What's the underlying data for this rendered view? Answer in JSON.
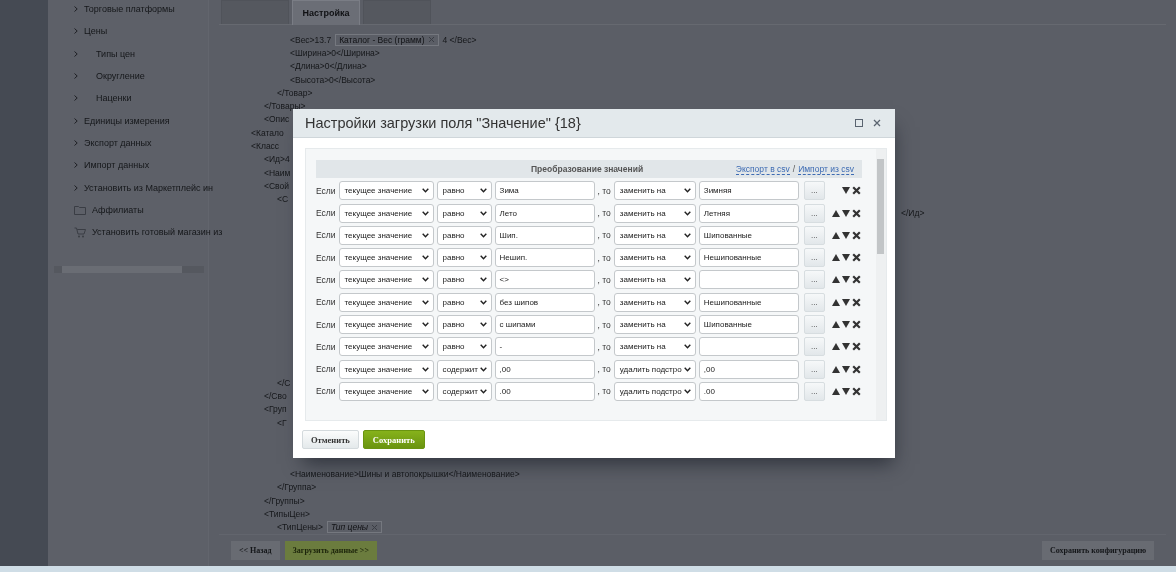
{
  "sidebar": {
    "items": [
      {
        "children": [
          {
            "label": "Торговые платформы"
          },
          {
            "label": "Цены",
            "children": [
              {
                "label": "Типы цен"
              },
              {
                "label": "Округление"
              },
              {
                "label": "Наценки"
              }
            ]
          },
          {
            "label": "Единицы измерения"
          },
          {
            "label": "Экспорт данных"
          },
          {
            "label": "Импорт данных"
          },
          {
            "label": "Установить из Маркетплейс ин"
          }
        ]
      },
      {
        "label": "Аффилиаты",
        "kind": "folder"
      },
      {
        "label": "Установить готовый магазин из",
        "kind": "cart"
      }
    ]
  },
  "tabs": [
    {
      "selected": false
    },
    {
      "label": "Настройка",
      "selected": true
    },
    {
      "selected": false
    }
  ],
  "xml_sections": [
    [
      {
        "children": [
          {
            "children": [
              {
                "children": [
                  {
                    "text": "<Вес>13.7",
                    "tag": "Каталог - Вес (грамм)",
                    "tail": "4 </Вес>"
                  },
                  {
                    "text": "<Ширина>0</Ширина>"
                  },
                  {
                    "text": "<Длина>0</Длина>"
                  },
                  {
                    "text": "<Высота>0</Высота>"
                  }
                ]
              },
              {
                "text": "</Товар>"
              }
            ]
          },
          {
            "text": "</Товары>"
          },
          {
            "text": "<Опис"
          }
        ]
      },
      {
        "text": "<Катало"
      },
      {
        "text": "<Класс",
        "children": [
          {
            "text": "<Ид>4"
          },
          {
            "text": "<Наим"
          },
          {
            "text": "<Свой",
            "children": [
              {
                "text": "<С"
              }
            ]
          }
        ]
      }
    ],
    [
      {
        "text": "</Ид>"
      }
    ],
    [
      {
        "children": [
          {
            "children": [
              {
                "text": "</С"
              }
            ]
          },
          {
            "text": "</Сво"
          },
          {
            "text": "<Груп",
            "children": [
              {
                "text": "<Г"
              }
            ]
          }
        ]
      }
    ],
    [
      {
        "children": [
          {
            "children": [
              {
                "children": [
                  {
                    "text": "<Наименование>Шины и автопокрышки</Наименование>"
                  }
                ]
              },
              {
                "text": "</Группа>"
              }
            ]
          },
          {
            "text": "</Группы>"
          },
          {
            "text": "<ТипыЦен>",
            "children": [
              {
                "text": "<ТипЦены>",
                "tag": "Тип цены"
              }
            ]
          }
        ]
      }
    ]
  ],
  "footer": {
    "back": "<< Назад",
    "load": "Загрузить данные >>",
    "save_config": "Сохранить конфигурацию"
  },
  "dialog": {
    "title": "Настройки загрузки поля \"Значение\" {18}",
    "section_title": "Преобразование значений",
    "export_link": "Экспорт в csv",
    "separator": "/",
    "import_link": "Импорт из csv",
    "rows": [
      {
        "if_label": "Если",
        "subject": "текущее значение",
        "condition": "равно",
        "value": "Зима",
        "then_label": ", то",
        "action": "заменить на",
        "replacement": "Зимняя",
        "more": "...",
        "can_move_up": false,
        "can_move_down": true
      },
      {
        "if_label": "Если",
        "subject": "текущее значение",
        "condition": "равно",
        "value": "Лето",
        "then_label": ", то",
        "action": "заменить на",
        "replacement": "Летняя",
        "more": "...",
        "can_move_up": true,
        "can_move_down": true
      },
      {
        "if_label": "Если",
        "subject": "текущее значение",
        "condition": "равно",
        "value": "Шип.",
        "then_label": ", то",
        "action": "заменить на",
        "replacement": "Шипованные",
        "more": "...",
        "can_move_up": true,
        "can_move_down": true
      },
      {
        "if_label": "Если",
        "subject": "текущее значение",
        "condition": "равно",
        "value": "Нешип.",
        "then_label": ", то",
        "action": "заменить на",
        "replacement": "Нешипованные",
        "more": "...",
        "can_move_up": true,
        "can_move_down": true
      },
      {
        "if_label": "Если",
        "subject": "текущее значение",
        "condition": "равно",
        "value": "<>",
        "then_label": ", то",
        "action": "заменить на",
        "more": "...",
        "can_move_up": true,
        "can_move_down": true
      },
      {
        "if_label": "Если",
        "subject": "текущее значение",
        "condition": "равно",
        "value": "без шипов",
        "then_label": ", то",
        "action": "заменить на",
        "replacement": "Нешипованные",
        "more": "...",
        "can_move_up": true,
        "can_move_down": true
      },
      {
        "if_label": "Если",
        "subject": "текущее значение",
        "condition": "равно",
        "value": "с шипами",
        "then_label": ", то",
        "action": "заменить на",
        "replacement": "Шипованные",
        "more": "...",
        "can_move_up": true,
        "can_move_down": true
      },
      {
        "if_label": "Если",
        "subject": "текущее значение",
        "condition": "равно",
        "value": "-",
        "then_label": ", то",
        "action": "заменить на",
        "more": "...",
        "can_move_up": true,
        "can_move_down": true
      },
      {
        "if_label": "Если",
        "subject": "текущее значение",
        "condition": "содержит",
        "value": ",00",
        "then_label": ", то",
        "action": "удалить подстро",
        "replacement": ",00",
        "more": "...",
        "can_move_up": true,
        "can_move_down": true
      },
      {
        "if_label": "Если",
        "subject": "текущее значение",
        "condition": "содержит",
        "value": ".00",
        "then_label": ", то",
        "action": "удалить подстро",
        "replacement": ".00",
        "more": "...",
        "can_move_up": true,
        "can_move_down": true
      }
    ],
    "cancel": "Отменить",
    "save": "Сохранить"
  }
}
